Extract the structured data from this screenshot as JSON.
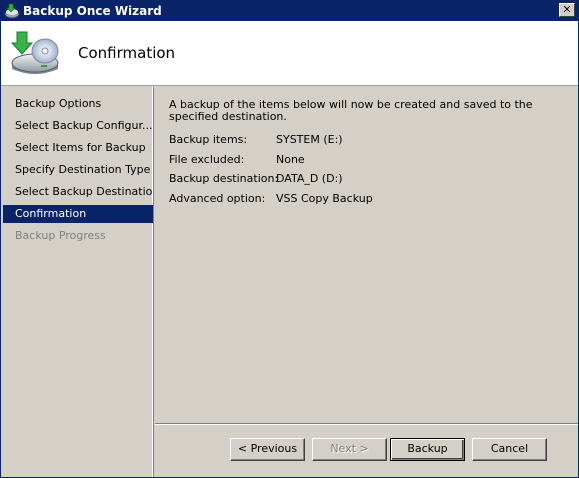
{
  "window": {
    "title": "Backup Once Wizard",
    "close_glyph": "✕"
  },
  "header": {
    "title": "Confirmation",
    "icon": "backup-disk-arrow-icon"
  },
  "nav": {
    "items": [
      {
        "label": "Backup Options",
        "state": "normal"
      },
      {
        "label": "Select Backup Configur...",
        "state": "normal"
      },
      {
        "label": "Select Items for Backup",
        "state": "normal"
      },
      {
        "label": "Specify Destination Type",
        "state": "normal"
      },
      {
        "label": "Select Backup Destination",
        "state": "normal"
      },
      {
        "label": "Confirmation",
        "state": "selected"
      },
      {
        "label": "Backup Progress",
        "state": "disabled"
      }
    ]
  },
  "main": {
    "intro": "A backup of the items below will now be created and saved to the specified destination.",
    "details": [
      {
        "label": "Backup items:",
        "value": "SYSTEM (E:)"
      },
      {
        "label": "File excluded:",
        "value": "None"
      },
      {
        "label": "Backup destination:",
        "value": "DATA_D (D:)"
      },
      {
        "label": "Advanced option:",
        "value": "VSS Copy Backup"
      }
    ]
  },
  "buttons": {
    "previous": "< Previous",
    "next": "Next >",
    "backup": "Backup",
    "cancel": "Cancel"
  },
  "colors": {
    "titlebar": "#0a246a",
    "selection": "#0a246a",
    "face": "#d4d0c8"
  }
}
